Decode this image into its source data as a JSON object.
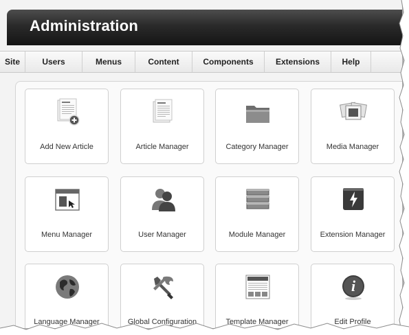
{
  "header": {
    "title": "Administration"
  },
  "menu": {
    "items": [
      {
        "label": "Site"
      },
      {
        "label": "Users"
      },
      {
        "label": "Menus"
      },
      {
        "label": "Content"
      },
      {
        "label": "Components"
      },
      {
        "label": "Extensions"
      },
      {
        "label": "Help"
      }
    ]
  },
  "tiles": [
    {
      "label": "Add New Article",
      "icon": "add-article-icon"
    },
    {
      "label": "Article Manager",
      "icon": "article-icon"
    },
    {
      "label": "Category Manager",
      "icon": "folder-icon"
    },
    {
      "label": "Media Manager",
      "icon": "media-icon"
    },
    {
      "label": "Menu Manager",
      "icon": "menu-icon"
    },
    {
      "label": "User Manager",
      "icon": "users-icon"
    },
    {
      "label": "Module Manager",
      "icon": "module-icon"
    },
    {
      "label": "Extension Manager",
      "icon": "extension-icon"
    },
    {
      "label": "Language Manager",
      "icon": "globe-icon"
    },
    {
      "label": "Global Configuration",
      "icon": "tools-icon"
    },
    {
      "label": "Template Manager",
      "icon": "template-icon"
    },
    {
      "label": "Edit Profile",
      "icon": "info-icon"
    }
  ]
}
